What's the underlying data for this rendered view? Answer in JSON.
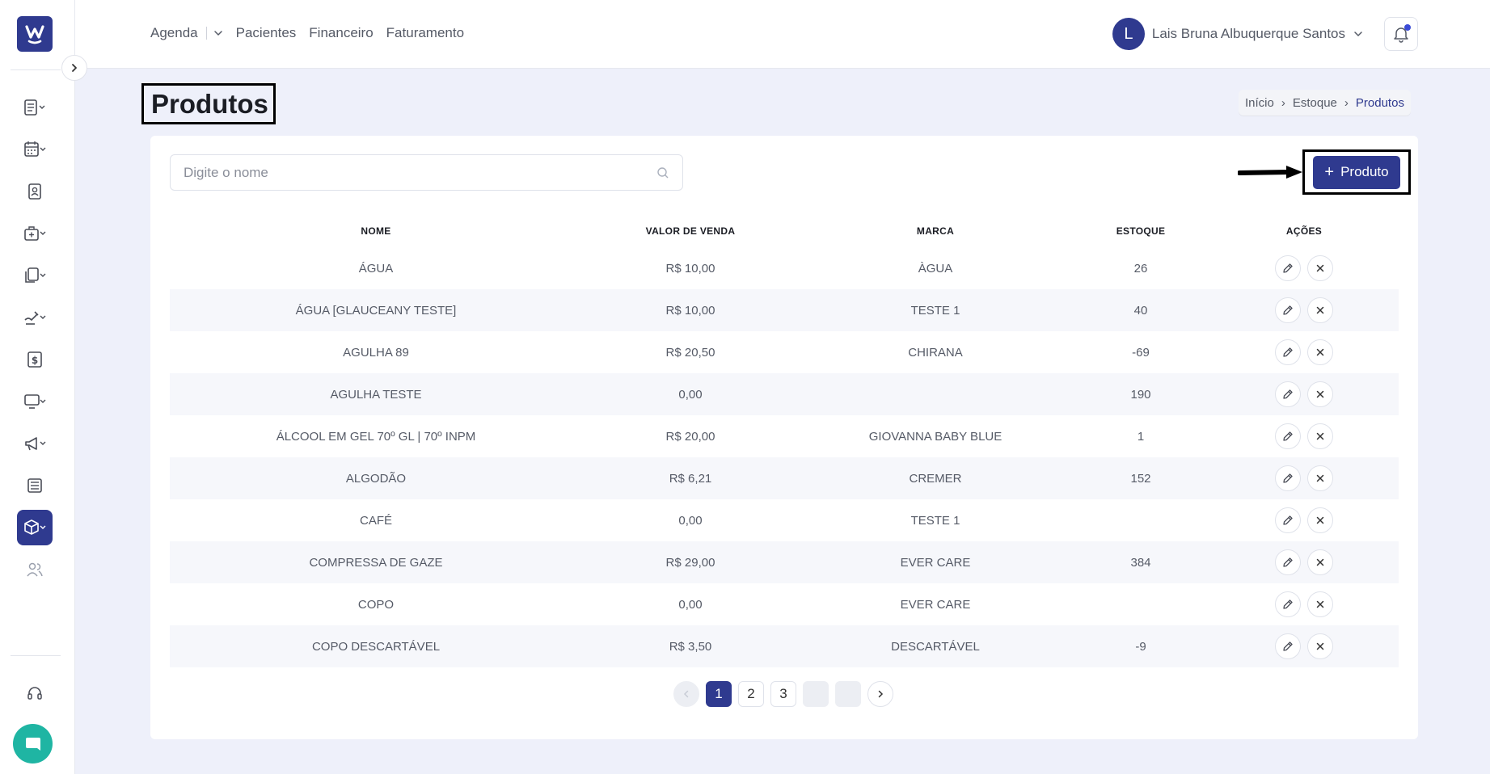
{
  "header": {
    "nav": [
      "Agenda",
      "Pacientes",
      "Financeiro",
      "Faturamento"
    ],
    "user_initial": "L",
    "user_name": "Lais Bruna Albuquerque Santos"
  },
  "sidebar": {
    "logo_letter": "W",
    "items": [
      {
        "icon": "clipboard-list-icon"
      },
      {
        "icon": "calendar-icon"
      },
      {
        "icon": "patient-card-icon"
      },
      {
        "icon": "medical-bag-icon"
      },
      {
        "icon": "documents-icon"
      },
      {
        "icon": "hand-pen-icon"
      },
      {
        "icon": "dollar-icon"
      },
      {
        "icon": "monitor-icon"
      },
      {
        "icon": "megaphone-icon"
      },
      {
        "icon": "news-icon"
      },
      {
        "icon": "box-icon",
        "active": true
      },
      {
        "icon": "users-icon"
      }
    ]
  },
  "page": {
    "title": "Produtos",
    "breadcrumb": [
      "Início",
      "Estoque",
      "Produtos"
    ],
    "search_placeholder": "Digite o nome",
    "add_button": "Produto"
  },
  "table": {
    "columns": [
      "NOME",
      "VALOR DE VENDA",
      "MARCA",
      "ESTOQUE",
      "AÇÕES"
    ],
    "rows": [
      {
        "nome": "ÁGUA",
        "valor": "R$ 10,00",
        "marca": "ÀGUA",
        "estoque": "26"
      },
      {
        "nome": "ÁGUA [GLAUCEANY TESTE]",
        "valor": "R$ 10,00",
        "marca": "TESTE 1",
        "estoque": "40"
      },
      {
        "nome": "AGULHA 89",
        "valor": "R$ 20,50",
        "marca": "CHIRANA",
        "estoque": "-69"
      },
      {
        "nome": "AGULHA TESTE",
        "valor": "0,00",
        "marca": "",
        "estoque": "190"
      },
      {
        "nome": "ÁLCOOL EM GEL 70º GL | 70º INPM",
        "valor": "R$ 20,00",
        "marca": "GIOVANNA BABY BLUE",
        "estoque": "1"
      },
      {
        "nome": "ALGODÃO",
        "valor": "R$ 6,21",
        "marca": "CREMER",
        "estoque": "152"
      },
      {
        "nome": "CAFÉ",
        "valor": "0,00",
        "marca": "TESTE 1",
        "estoque": ""
      },
      {
        "nome": "COMPRESSA DE GAZE",
        "valor": "R$ 29,00",
        "marca": "EVER CARE",
        "estoque": "384"
      },
      {
        "nome": "COPO",
        "valor": "0,00",
        "marca": "EVER CARE",
        "estoque": ""
      },
      {
        "nome": "COPO DESCARTÁVEL",
        "valor": "R$ 3,50",
        "marca": "DESCARTÁVEL",
        "estoque": "-9"
      }
    ]
  },
  "pagination": {
    "pages": [
      "1",
      "2",
      "3",
      "",
      ""
    ],
    "current": "1"
  },
  "colors": {
    "primary": "#2f3a8f",
    "chat": "#1fb5a3",
    "background": "#eef0fa"
  }
}
